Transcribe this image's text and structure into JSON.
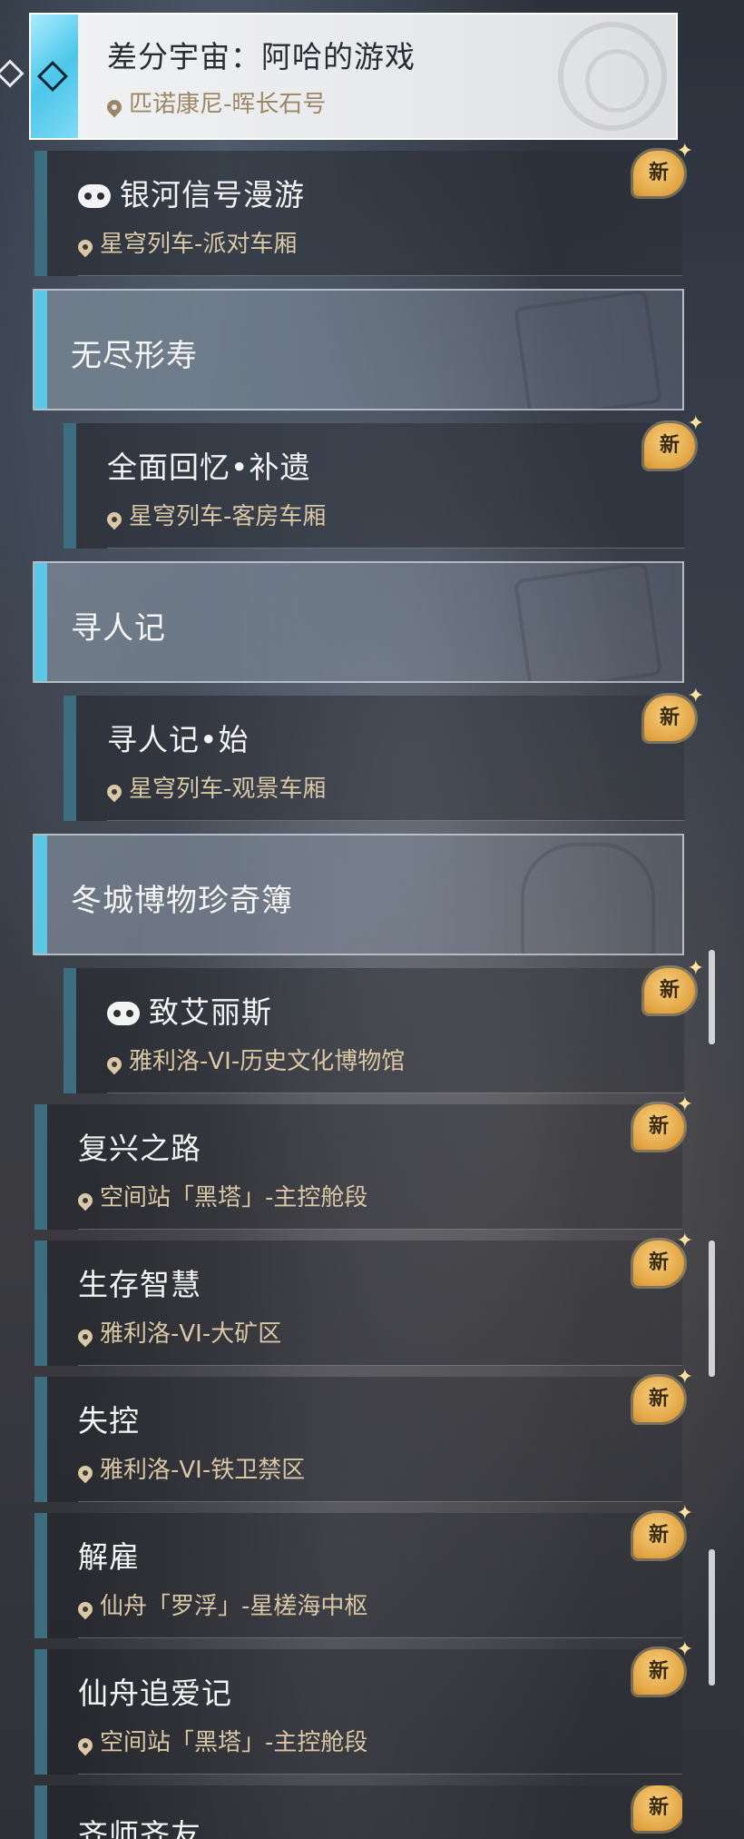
{
  "hero": {
    "title": "差分宇宙：阿哈的游戏",
    "location": "匹诺康尼-晖长石号"
  },
  "badge_label": "新",
  "items": [
    {
      "title": "银河信号漫游",
      "location": "星穹列车-派对车厢",
      "has_controller_icon": true
    },
    {
      "title": "无尽形寿",
      "category": true
    },
    {
      "title": "全面回忆•补遗",
      "location": "星穹列车-客房车厢"
    },
    {
      "title": "寻人记",
      "category": true
    },
    {
      "title": "寻人记•始",
      "location": "星穹列车-观景车厢"
    },
    {
      "title": "冬城博物珍奇簿",
      "category": true
    },
    {
      "title": "致艾丽斯",
      "location": "雅利洛-VI-历史文化博物馆",
      "has_controller_icon": true
    },
    {
      "title": "复兴之路",
      "location": "空间站「黑塔」-主控舱段"
    },
    {
      "title": "生存智慧",
      "location": "雅利洛-VI-大矿区"
    },
    {
      "title": "失控",
      "location": "雅利洛-VI-铁卫禁区"
    },
    {
      "title": "解雇",
      "location": "仙舟「罗浮」-星槎海中枢"
    },
    {
      "title": "仙舟追爱记",
      "location": "空间站「黑塔」-主控舱段"
    },
    {
      "title": "齐师齐友",
      "location": ""
    }
  ],
  "colors": {
    "accent_cyan": "#5cc8e8",
    "item_bar": "#3d6e80",
    "location_text": "#d9c7a6",
    "badge": "#e2a443"
  }
}
